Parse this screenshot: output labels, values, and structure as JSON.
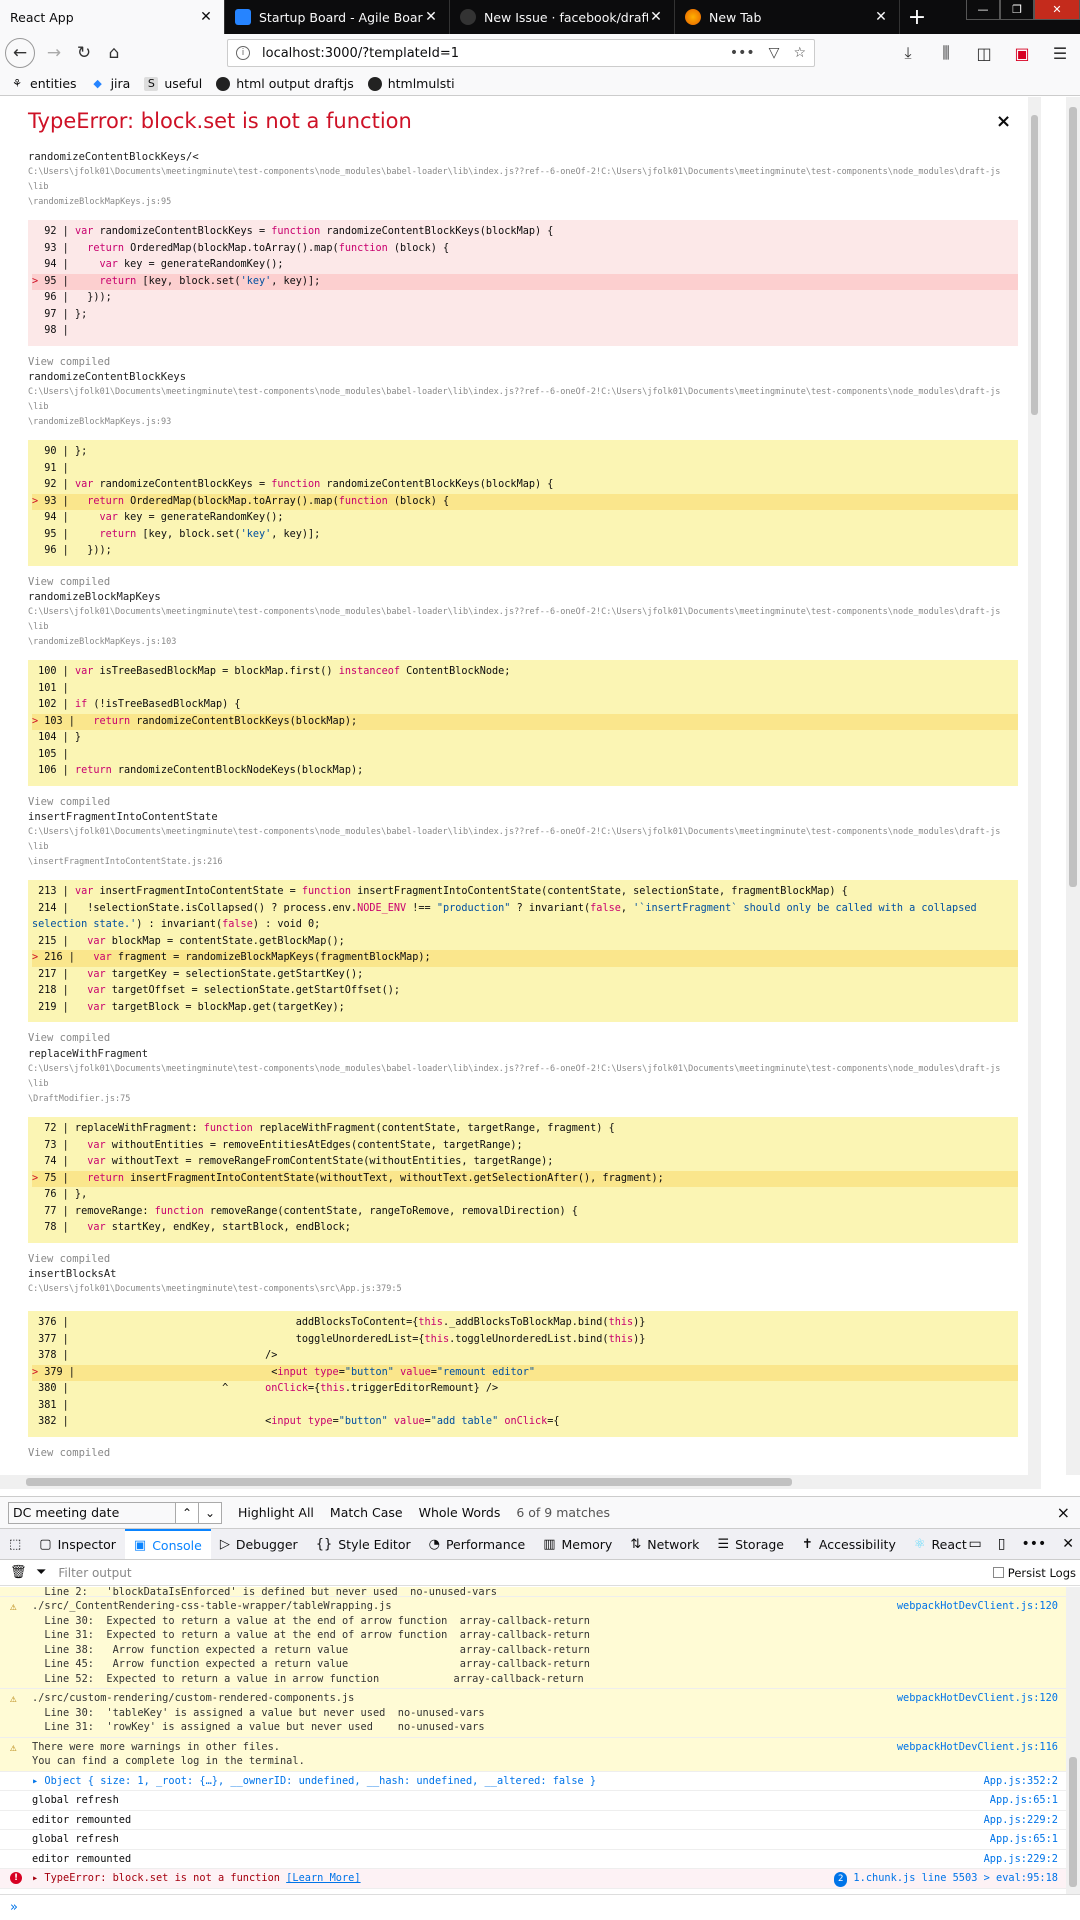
{
  "tabs": [
    {
      "label": "React App",
      "active": true
    },
    {
      "label": "Startup Board - Agile Board - G",
      "active": false
    },
    {
      "label": "New Issue · facebook/draft-js",
      "active": false
    },
    {
      "label": "New Tab",
      "active": false
    }
  ],
  "new_tab_symbol": "+",
  "address": {
    "url": "localhost:3000/?templateId=1"
  },
  "bookmarks": [
    {
      "label": "entities",
      "icon": "entities-icon"
    },
    {
      "label": "jira",
      "icon": "jira-icon"
    },
    {
      "label": "useful",
      "icon": "s-icon",
      "icon_text": "S"
    },
    {
      "label": "html output draftjs",
      "icon": "github-icon"
    },
    {
      "label": "htmlmulsti",
      "icon": "github-icon"
    }
  ],
  "overlay": {
    "title": "TypeError: block.set is not a function",
    "close": "×",
    "view_compiled": "View compiled",
    "frames": [
      {
        "name": "randomizeContentBlockKeys/<",
        "path": "C:\\Users\\jfolk01\\Documents\\meetingminute\\test-components\\node_modules\\babel-loader\\lib\\index.js??ref--6-oneOf-2!C:\\Users\\jfolk01\\Documents\\meetingminute\\test-components\\node_modules\\draft-js\\lib\n\\randomizeBlockMapKeys.js:95",
        "red": true
      },
      {
        "name": "randomizeContentBlockKeys",
        "path": "C:\\Users\\jfolk01\\Documents\\meetingminute\\test-components\\node_modules\\babel-loader\\lib\\index.js??ref--6-oneOf-2!C:\\Users\\jfolk01\\Documents\\meetingminute\\test-components\\node_modules\\draft-js\\lib\n\\randomizeBlockMapKeys.js:93",
        "red": false
      },
      {
        "name": "randomizeBlockMapKeys",
        "path": "C:\\Users\\jfolk01\\Documents\\meetingminute\\test-components\\node_modules\\babel-loader\\lib\\index.js??ref--6-oneOf-2!C:\\Users\\jfolk01\\Documents\\meetingminute\\test-components\\node_modules\\draft-js\\lib\n\\randomizeBlockMapKeys.js:103",
        "red": false
      },
      {
        "name": "insertFragmentIntoContentState",
        "path": "C:\\Users\\jfolk01\\Documents\\meetingminute\\test-components\\node_modules\\babel-loader\\lib\\index.js??ref--6-oneOf-2!C:\\Users\\jfolk01\\Documents\\meetingminute\\test-components\\node_modules\\draft-js\\lib\n\\insertFragmentIntoContentState.js:216",
        "red": false
      },
      {
        "name": "replaceWithFragment",
        "path": "C:\\Users\\jfolk01\\Documents\\meetingminute\\test-components\\node_modules\\babel-loader\\lib\\index.js??ref--6-oneOf-2!C:\\Users\\jfolk01\\Documents\\meetingminute\\test-components\\node_modules\\draft-js\\lib\n\\DraftModifier.js:75",
        "red": false
      },
      {
        "name": "insertBlocksAt",
        "path": "C:\\Users\\jfolk01\\Documents\\meetingminute\\test-components\\src\\App.js:379:5",
        "red": false
      }
    ]
  },
  "find": {
    "query": "DC meeting date",
    "up": "⌃",
    "down": "⌄",
    "highlight_all": "Highlight All",
    "match_case": "Match Case",
    "whole_words": "Whole Words",
    "status": "6 of 9 matches",
    "close": "×"
  },
  "devtools": {
    "tabs": [
      {
        "label": "Inspector",
        "icon": "inspector-icon",
        "glyph": "▢"
      },
      {
        "label": "Console",
        "icon": "console-icon",
        "glyph": "▣",
        "active": true
      },
      {
        "label": "Debugger",
        "icon": "debugger-icon",
        "glyph": "▷"
      },
      {
        "label": "Style Editor",
        "icon": "style-editor-icon",
        "glyph": "{}"
      },
      {
        "label": "Performance",
        "icon": "performance-icon",
        "glyph": "◔"
      },
      {
        "label": "Memory",
        "icon": "memory-icon",
        "glyph": "▥"
      },
      {
        "label": "Network",
        "icon": "network-icon",
        "glyph": "⇅"
      },
      {
        "label": "Storage",
        "icon": "storage-icon",
        "glyph": "☰"
      },
      {
        "label": "Accessibility",
        "icon": "accessibility-icon",
        "glyph": "✝"
      },
      {
        "label": "React",
        "icon": "react-icon",
        "glyph": "⚛"
      }
    ],
    "filter_placeholder": "Filter output",
    "persist_logs": "Persist Logs"
  },
  "console": {
    "messages": [
      {
        "type": "warn",
        "cont": true,
        "text": "  Line 2:   'blockDataIsEnforced' is defined but never used  no-unused-vars",
        "loc": ""
      },
      {
        "type": "warn",
        "text": "./src/_ContentRendering-css-table-wrapper/tableWrapping.js\n  Line 30:  Expected to return a value at the end of arrow function  array-callback-return\n  Line 31:  Expected to return a value at the end of arrow function  array-callback-return\n  Line 38:   Arrow function expected a return value                  array-callback-return\n  Line 45:   Arrow function expected a return value                  array-callback-return\n  Line 52:  Expected to return a value in arrow function            array-callback-return",
        "loc": "webpackHotDevClient.js:120"
      },
      {
        "type": "warn",
        "text": "./src/custom-rendering/custom-rendered-components.js\n  Line 30:  'tableKey' is assigned a value but never used  no-unused-vars\n  Line 31:  'rowKey' is assigned a value but never used    no-unused-vars",
        "loc": "webpackHotDevClient.js:120"
      },
      {
        "type": "warn",
        "text": "There were more warnings in other files.\nYou can find a complete log in the terminal.",
        "loc": "webpackHotDevClient.js:116"
      },
      {
        "type": "log",
        "text": "▸ Object { size: 1, _root: {…}, __ownerID: undefined, __hash: undefined, __altered: false }",
        "loc": "App.js:352:2",
        "object": true
      },
      {
        "type": "log",
        "text": "global refresh",
        "loc": "App.js:65:1"
      },
      {
        "type": "log",
        "text": "editor remounted",
        "loc": "App.js:229:2"
      },
      {
        "type": "log",
        "text": "global refresh",
        "loc": "App.js:65:1"
      },
      {
        "type": "log",
        "text": "editor remounted",
        "loc": "App.js:229:2"
      },
      {
        "type": "error",
        "text": "▸ TypeError: block.set is not a function ",
        "link": "[Learn More]",
        "count": "2",
        "loc": "1.chunk.js line 5503 > eval:95:18"
      }
    ],
    "prompt": "»"
  }
}
